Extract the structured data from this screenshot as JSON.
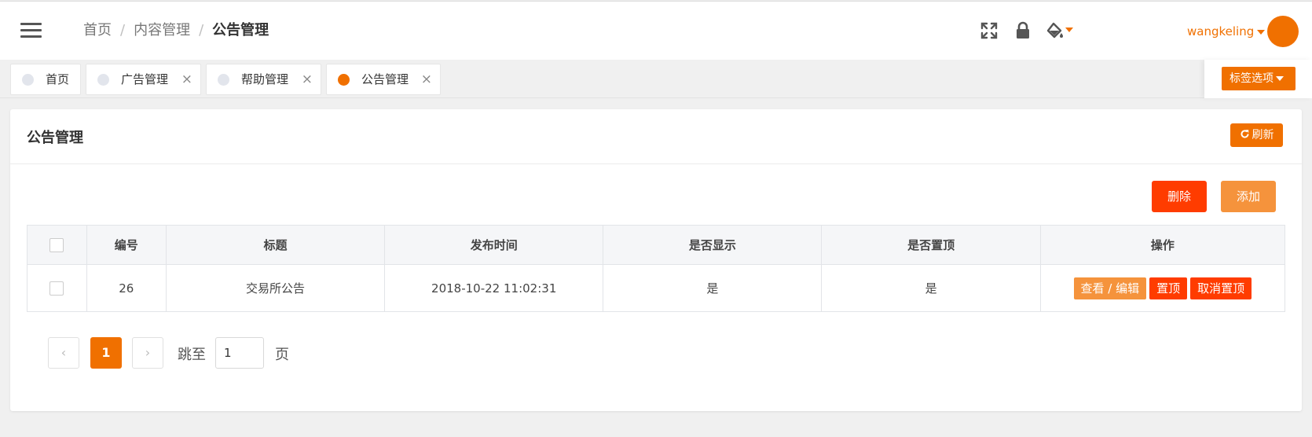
{
  "header": {
    "breadcrumb": [
      "首页",
      "内容管理",
      "公告管理"
    ],
    "breadcrumb_sep": "/",
    "user_name": "wangkeling",
    "icons": [
      "fullscreen-icon",
      "lock-icon",
      "theme-paint-icon"
    ]
  },
  "tabs": {
    "items": [
      {
        "label": "首页",
        "closable": false,
        "active": false
      },
      {
        "label": "广告管理",
        "closable": true,
        "active": false
      },
      {
        "label": "帮助管理",
        "closable": true,
        "active": false
      },
      {
        "label": "公告管理",
        "closable": true,
        "active": true
      }
    ],
    "close_glyph": "×",
    "options_label": "标签选项"
  },
  "card": {
    "title": "公告管理",
    "refresh_label": "刷新",
    "delete_label": "删除",
    "add_label": "添加"
  },
  "table": {
    "columns": [
      "编号",
      "标题",
      "发布时间",
      "是否显示",
      "是否置顶",
      "操作"
    ],
    "rows": [
      {
        "id": "26",
        "title": "交易所公告",
        "publish_time": "2018-10-22 11:02:31",
        "show": "是",
        "top": "是",
        "actions": [
          "查看 / 编辑",
          "置顶",
          "取消置顶"
        ]
      }
    ]
  },
  "pagination": {
    "current_page": "1",
    "prev_glyph": "‹",
    "next_glyph": "›",
    "jump_label": "跳至",
    "jump_value": "1",
    "page_suffix": "页"
  },
  "colors": {
    "accent": "#f07000",
    "danger": "#ff3c00",
    "add": "#f5933c"
  }
}
